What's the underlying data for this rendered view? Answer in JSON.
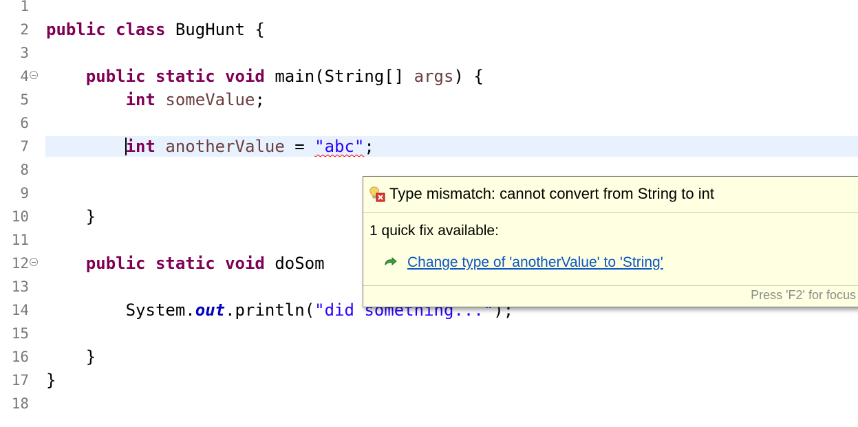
{
  "editor": {
    "lines": [
      {
        "n": "1",
        "tokens": []
      },
      {
        "n": "2",
        "tokens": [
          {
            "t": "public class",
            "c": "kw"
          },
          {
            "t": " BugHunt {",
            "c": ""
          }
        ]
      },
      {
        "n": "3",
        "tokens": []
      },
      {
        "n": "4",
        "fold": true,
        "tokens": [
          {
            "t": "    ",
            "c": ""
          },
          {
            "t": "public static void",
            "c": "kw"
          },
          {
            "t": " main(String[] ",
            "c": ""
          },
          {
            "t": "args",
            "c": "var"
          },
          {
            "t": ") {",
            "c": ""
          }
        ]
      },
      {
        "n": "5",
        "tokens": [
          {
            "t": "        ",
            "c": ""
          },
          {
            "t": "int",
            "c": "kw"
          },
          {
            "t": " ",
            "c": ""
          },
          {
            "t": "someValue",
            "c": "var"
          },
          {
            "t": ";",
            "c": ""
          }
        ]
      },
      {
        "n": "6",
        "tokens": []
      },
      {
        "n": "7",
        "current": true,
        "tokens": [
          {
            "t": "        ",
            "c": ""
          },
          {
            "t": "int",
            "c": "kw",
            "caret": true
          },
          {
            "t": " ",
            "c": ""
          },
          {
            "t": "anotherValue",
            "c": "var"
          },
          {
            "t": " = ",
            "c": ""
          },
          {
            "t": "\"abc\"",
            "c": "str squig"
          },
          {
            "t": ";",
            "c": ""
          }
        ]
      },
      {
        "n": "8",
        "tokens": []
      },
      {
        "n": "9",
        "tokens": []
      },
      {
        "n": "10",
        "tokens": [
          {
            "t": "    }",
            "c": ""
          }
        ]
      },
      {
        "n": "11",
        "tokens": []
      },
      {
        "n": "12",
        "fold": true,
        "tokens": [
          {
            "t": "    ",
            "c": ""
          },
          {
            "t": "public static void",
            "c": "kw"
          },
          {
            "t": " doSom",
            "c": ""
          }
        ]
      },
      {
        "n": "13",
        "tokens": []
      },
      {
        "n": "14",
        "tokens": [
          {
            "t": "        System.",
            "c": ""
          },
          {
            "t": "out",
            "c": "field"
          },
          {
            "t": ".println(",
            "c": ""
          },
          {
            "t": "\"did something...\"",
            "c": "str"
          },
          {
            "t": ");",
            "c": ""
          }
        ]
      },
      {
        "n": "15",
        "tokens": []
      },
      {
        "n": "16",
        "tokens": [
          {
            "t": "    }",
            "c": ""
          }
        ]
      },
      {
        "n": "17",
        "tokens": [
          {
            "t": "}",
            "c": ""
          }
        ]
      },
      {
        "n": "18",
        "tokens": []
      }
    ]
  },
  "hover": {
    "error_icon": "error-lightbulb-icon",
    "message": "Type mismatch: cannot convert from String to int",
    "fixes_title": "1 quick fix available:",
    "fix_icon": "change-type-icon",
    "fix_label": "Change type of 'anotherValue' to 'String'",
    "footer": "Press 'F2' for focus"
  }
}
